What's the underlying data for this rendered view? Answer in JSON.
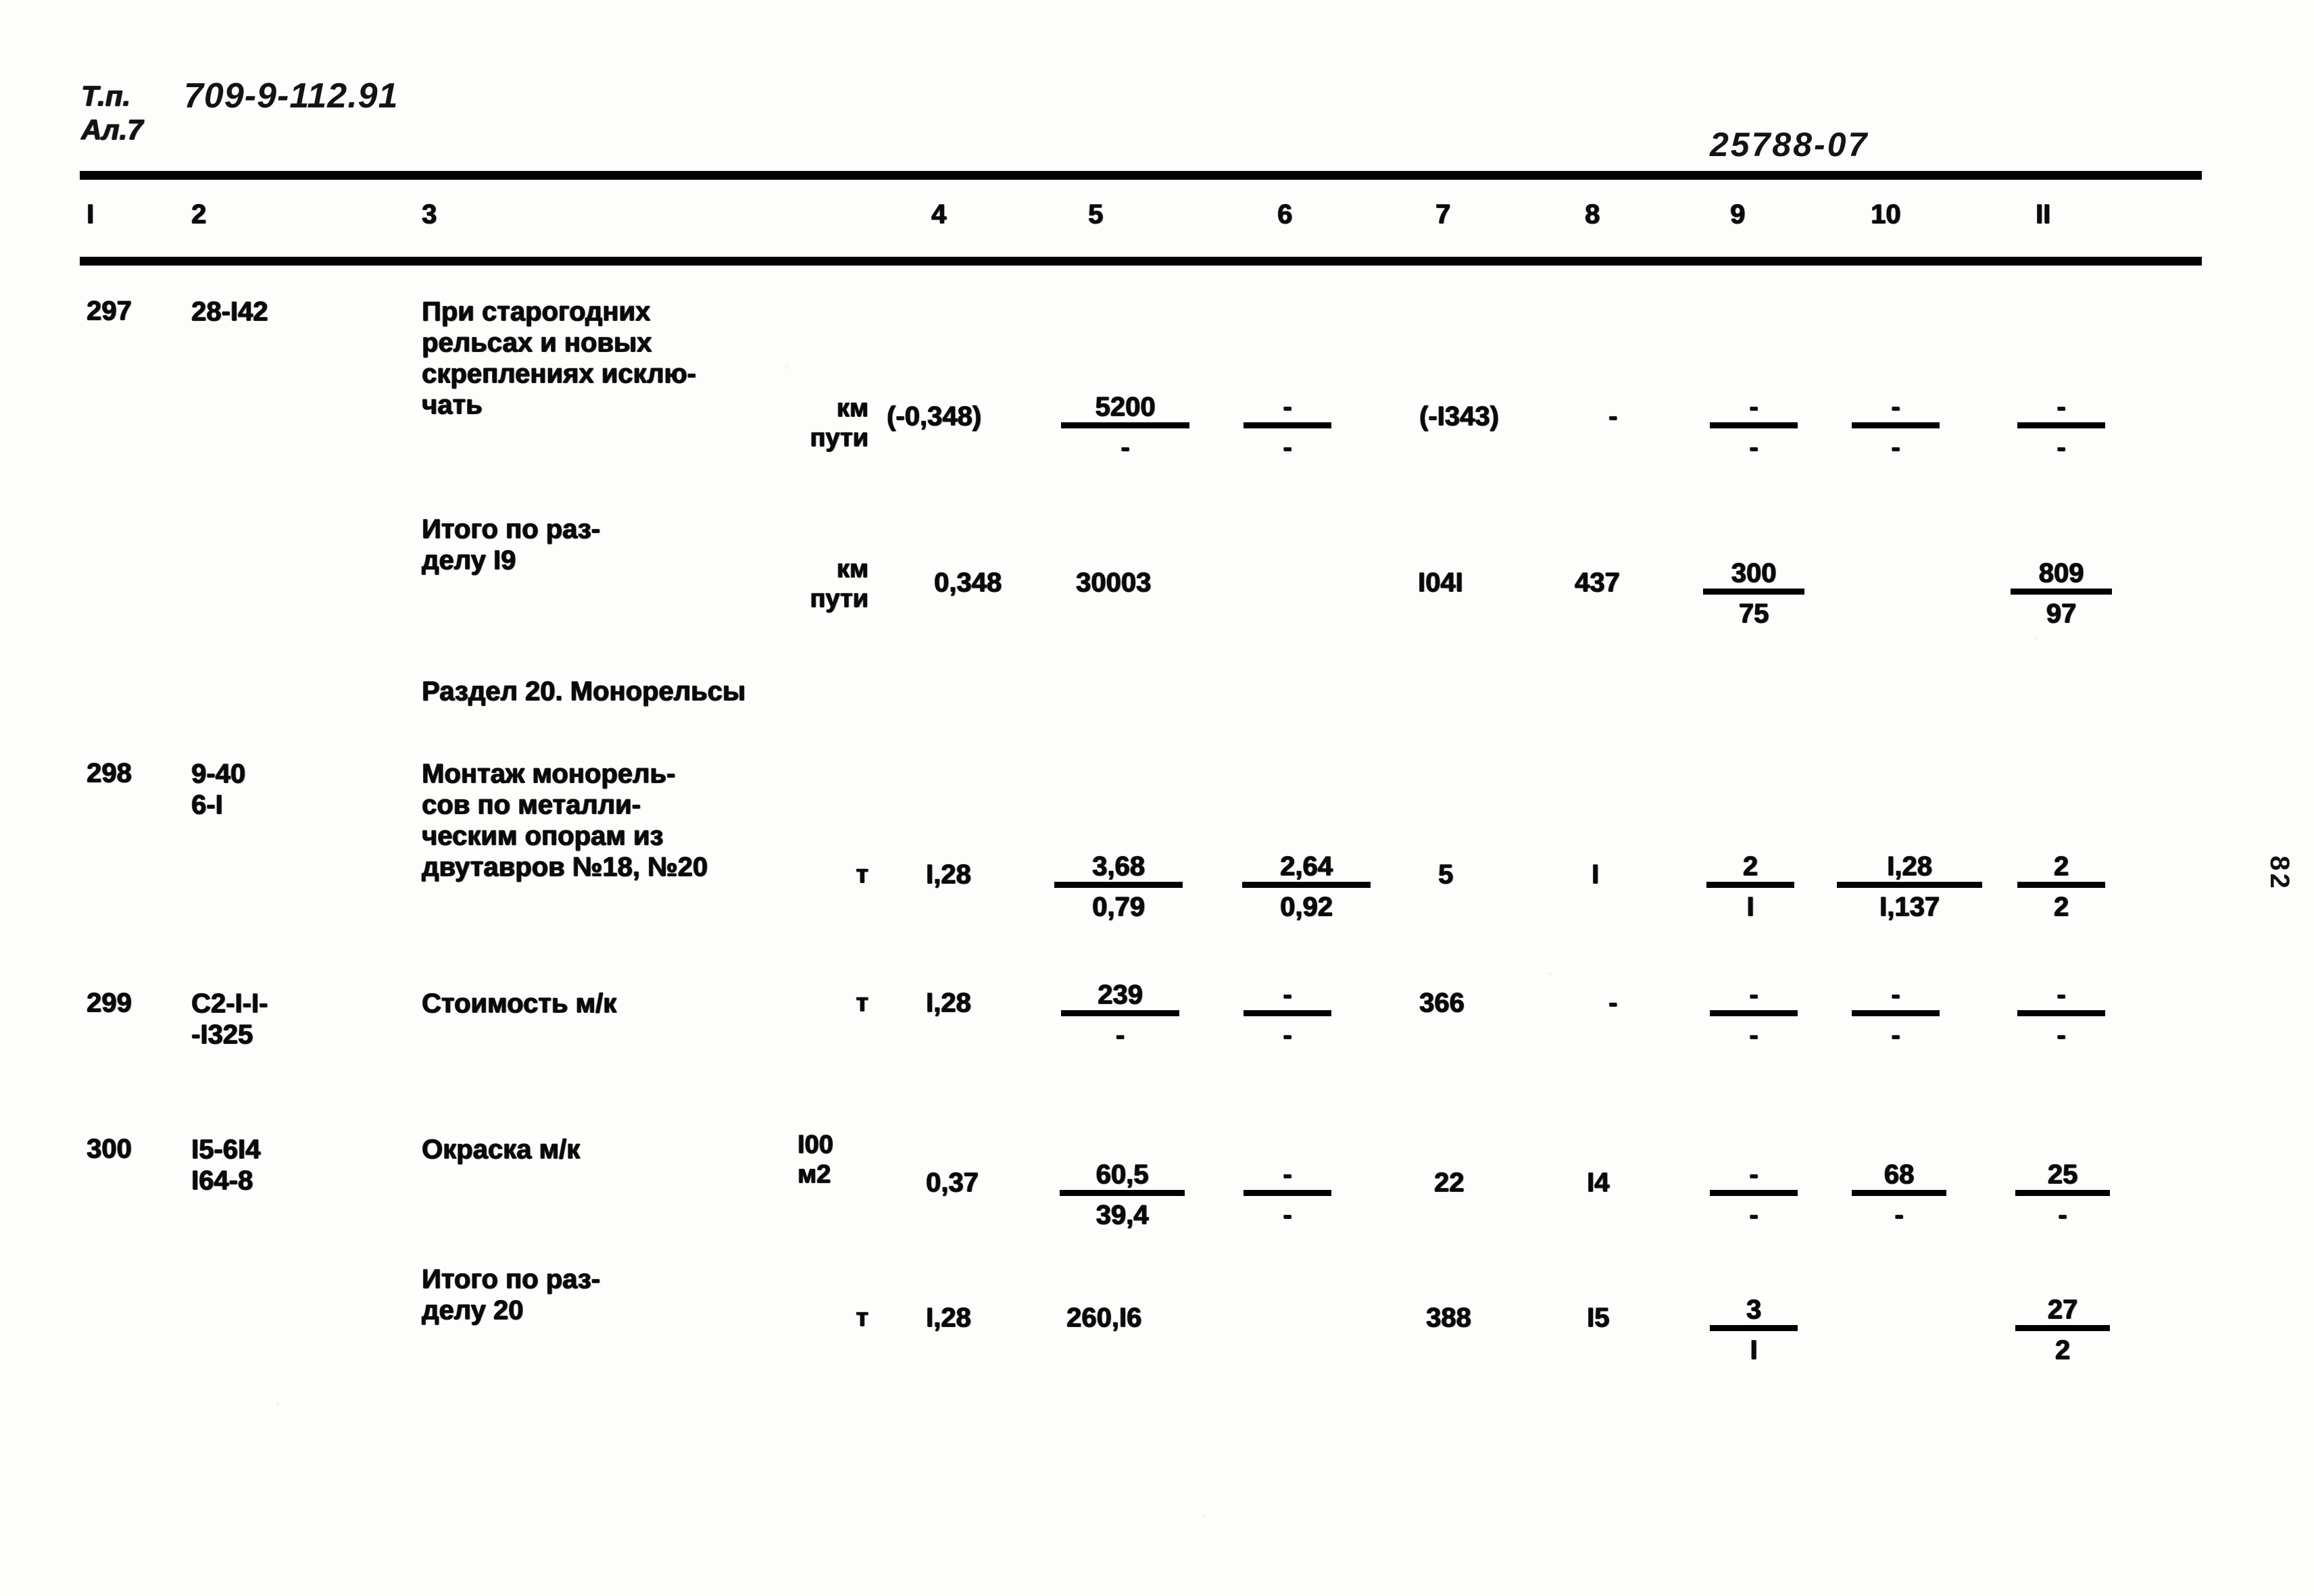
{
  "header": {
    "type_label": "Т.п.",
    "album_label": "Ал.7",
    "project_code": "709-9-112.91",
    "stamp": "25788-07",
    "page_number": "82"
  },
  "table": {
    "column_headers": [
      "I",
      "2",
      "3",
      "4",
      "5",
      "6",
      "7",
      "8",
      "9",
      "10",
      "II"
    ],
    "rows": [
      {
        "num": "297",
        "code": "28-I42",
        "description": "При старогодних\nрельсах и новых\nскреплениях исклю-\nчать",
        "unit": "км\nпути",
        "c4": "(-0,348)",
        "c5_num": "5200",
        "c5_den": "-",
        "c6_num": "-",
        "c6_den": "-",
        "c7": "(-I343)",
        "c8": "-",
        "c9_num": "-",
        "c9_den": "-",
        "c10_num": "-",
        "c10_den": "-",
        "c11_num": "-",
        "c11_den": "-"
      },
      {
        "num": "",
        "code": "",
        "description": "Итого по раз-\n   делу I9",
        "unit": "км\nпути",
        "c4": "0,348",
        "c5": "30003",
        "c6": "",
        "c7": "I04I",
        "c8": "437",
        "c9_num": "300",
        "c9_den": "75",
        "c10": "",
        "c11_num": "809",
        "c11_den": "97"
      },
      {
        "section_title": "Раздел 20.  Монорельсы"
      },
      {
        "num": "298",
        "code": "9-40\n6-I",
        "description": "Монтаж монорель-\nсов по металли-\nческим опорам из\nдвутавров №18, №20",
        "unit": "т",
        "c4": "I,28",
        "c5_num": "3,68",
        "c5_den": "0,79",
        "c6_num": "2,64",
        "c6_den": "0,92",
        "c7": "5",
        "c8": "I",
        "c9_num": "2",
        "c9_den": "I",
        "c10_num": "I,28",
        "c10_den": "I,137",
        "c11_num": "2",
        "c11_den": "2"
      },
      {
        "num": "299",
        "code": "С2-I-I-\n-I325",
        "description": "Стоимость м/к",
        "unit": "т",
        "c4": "I,28",
        "c5_num": "239",
        "c5_den": "-",
        "c6_num": "-",
        "c6_den": "-",
        "c7": "366",
        "c8": "-",
        "c9_num": "-",
        "c9_den": "-",
        "c10_num": "-",
        "c10_den": "-",
        "c11_num": "-",
        "c11_den": "-"
      },
      {
        "num": "300",
        "code": "I5-6I4\nI64-8",
        "description": "Окраска м/к",
        "unit": "I00\nм2",
        "c4": "0,37",
        "c5_num": "60,5",
        "c5_den": "39,4",
        "c6_num": "-",
        "c6_den": "-",
        "c7": "22",
        "c8": "I4",
        "c9_num": "-",
        "c9_den": "-",
        "c10_num": "68",
        "c10_den": "-",
        "c11_num": "25",
        "c11_den": "-"
      },
      {
        "num": "",
        "code": "",
        "description": "Итого по раз-\n   делу 20",
        "unit": "т",
        "c4": "I,28",
        "c5": "260,I6",
        "c6": "",
        "c7": "388",
        "c8": "I5",
        "c9_num": "3",
        "c9_den": "I",
        "c10": "",
        "c11_num": "27",
        "c11_den": "2"
      }
    ]
  }
}
